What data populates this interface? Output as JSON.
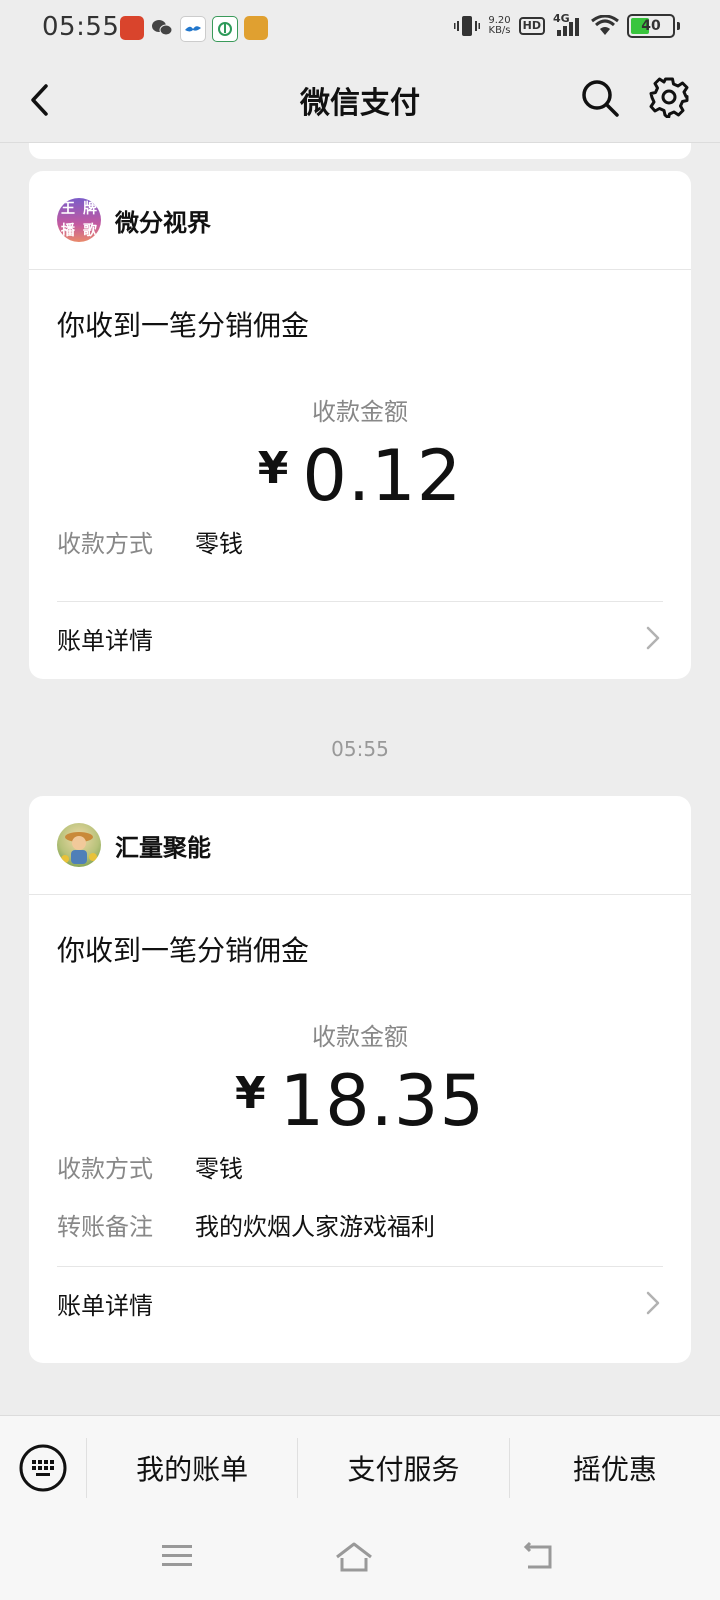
{
  "status_bar": {
    "time": "05:55",
    "net_speed_value": "9.20",
    "net_speed_unit": "KB/s",
    "hd": "HD",
    "network": "4G",
    "battery": "40"
  },
  "nav": {
    "title": "微信支付"
  },
  "messages": [
    {
      "merchant": "微分视界",
      "avatar_text": [
        "王",
        "牌",
        "播",
        "歌"
      ],
      "title": "你收到一笔分销佣金",
      "amount_label": "收款金额",
      "currency": "¥",
      "amount": "0.12",
      "fields": [
        {
          "key": "收款方式",
          "value": "零钱"
        }
      ],
      "detail_label": "账单详情"
    },
    {
      "merchant": "汇量聚能",
      "title": "你收到一笔分销佣金",
      "amount_label": "收款金额",
      "currency": "¥",
      "amount": "18.35",
      "fields": [
        {
          "key": "收款方式",
          "value": "零钱"
        },
        {
          "key": "转账备注",
          "value": "我的炊烟人家游戏福利"
        }
      ],
      "detail_label": "账单详情"
    }
  ],
  "timestamp_separator": "05:55",
  "bottom_menu": {
    "items": [
      "我的账单",
      "支付服务",
      "摇优惠"
    ]
  },
  "colors": {
    "background": "#ededed",
    "card": "#ffffff",
    "battery_green": "#39c53d",
    "muted_text": "#888888"
  },
  "icons": [
    "back-icon",
    "search-icon",
    "gear-icon",
    "chevron-right-icon",
    "keyboard-icon",
    "menu-icon",
    "home-icon",
    "return-icon"
  ]
}
